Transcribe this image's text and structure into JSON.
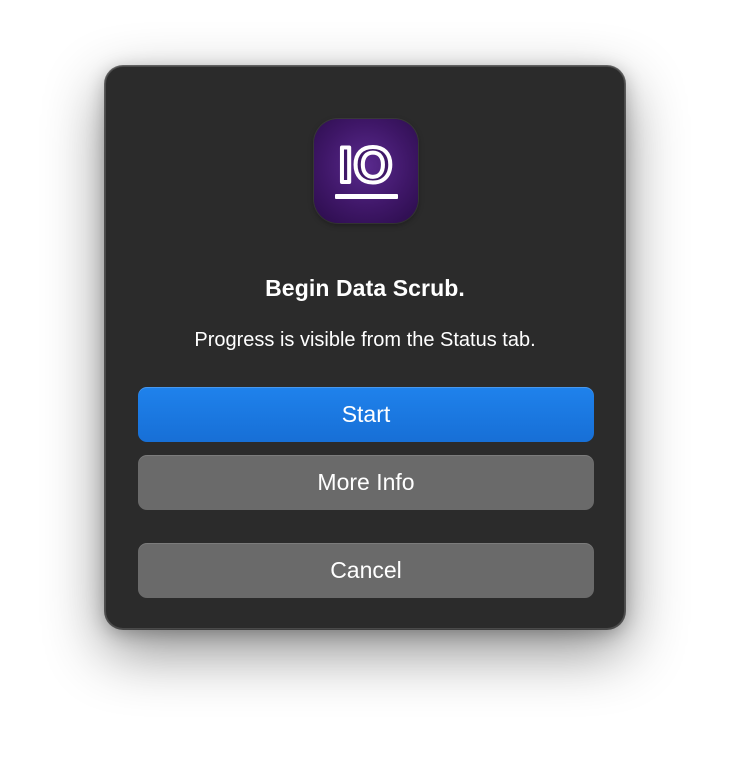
{
  "dialog": {
    "icon": "io-app-icon",
    "icon_text": "IO",
    "title": "Begin Data Scrub.",
    "message": "Progress is visible from the Status tab.",
    "buttons": {
      "start_label": "Start",
      "more_info_label": "More Info",
      "cancel_label": "Cancel"
    },
    "colors": {
      "dialog_background": "#2b2b2b",
      "primary_button": "#1a78e2",
      "secondary_button": "#6a6a6a",
      "icon_background": "#3f1768"
    }
  }
}
